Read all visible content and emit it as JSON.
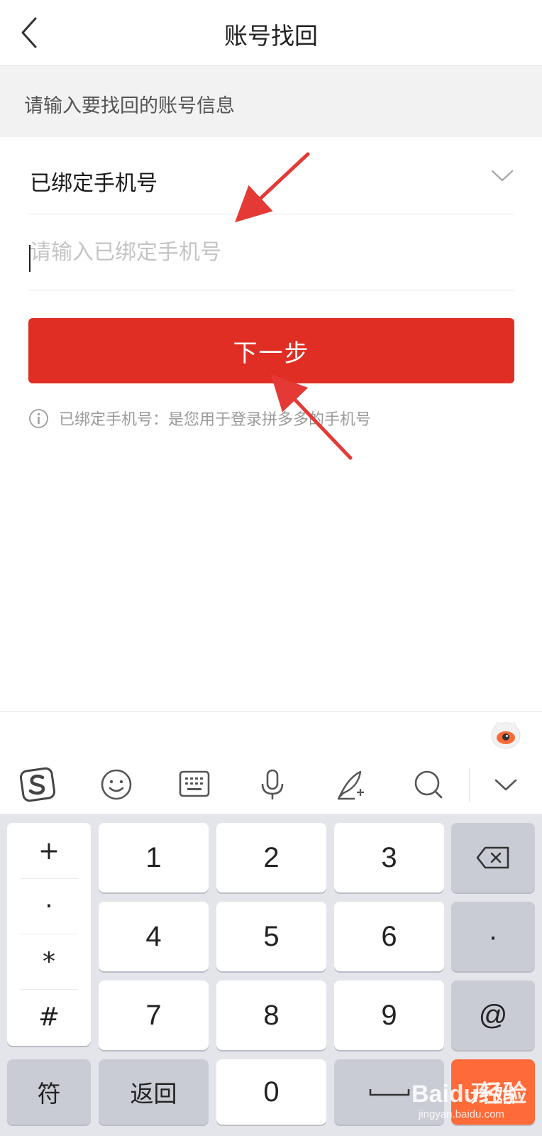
{
  "navbar": {
    "title": "账号找回"
  },
  "subheader": {
    "text": "请输入要找回的账号信息"
  },
  "form": {
    "selector_label": "已绑定手机号",
    "phone_placeholder": "请输入已绑定手机号",
    "phone_value": "",
    "next_label": "下一步",
    "hint": "已绑定手机号：是您用于登录拼多多的手机号"
  },
  "colors": {
    "primary_red": "#e02e24",
    "keyboard_bg": "#e3e5eb",
    "enter_key": "#ff6b38"
  },
  "keyboard": {
    "toolbar_icons": [
      "sogou-logo-icon",
      "emoji-icon",
      "keyboard-icon",
      "microphone-icon",
      "handwriting-icon",
      "search-icon",
      "collapse-keyboard-icon"
    ],
    "symbols": [
      "+",
      "·",
      "*",
      "#"
    ],
    "row1": [
      "1",
      "2",
      "3"
    ],
    "row2": [
      "4",
      "5",
      "6"
    ],
    "row3": [
      "7",
      "8",
      "9"
    ],
    "dot_key": "·",
    "at_key": "@",
    "symbol_key": "符",
    "back_key": "返回",
    "zero_key": "0",
    "enter_key": "开始"
  },
  "watermark": {
    "main": "Baidu经验",
    "sub": "jingyan.baidu.com"
  }
}
